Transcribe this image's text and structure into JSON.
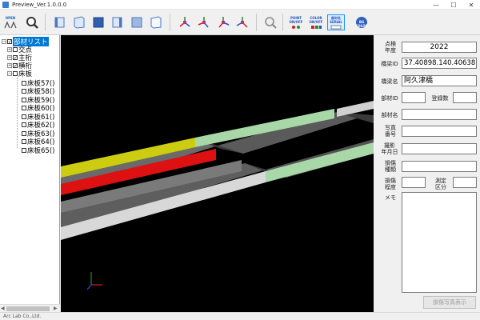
{
  "window": {
    "title": "Preview_Ver.1.0.0.0",
    "controls": [
      "—",
      "☐",
      "✕"
    ]
  },
  "toolbar": {
    "open_label": "OPEN",
    "point_label": "POINT\nON/OFF",
    "color_label": "COLOR\nON/OFF",
    "edit_label": "部材名\nSERIAL",
    "bg_color_label": "BG\nCOLOR"
  },
  "tree": {
    "root_label": "部材リスト",
    "nodes": [
      {
        "label": "交点",
        "expanded": false,
        "checked": false
      },
      {
        "label": "主桁",
        "expanded": false,
        "checked": true
      },
      {
        "label": "横桁",
        "expanded": false,
        "checked": true
      },
      {
        "label": "床板",
        "expanded": true,
        "checked": false
      }
    ],
    "children": [
      "床板57()",
      "床板58()",
      "床板59()",
      "床板60()",
      "床板61()",
      "床板62()",
      "床板63()",
      "床板64()",
      "床板65()"
    ]
  },
  "details": {
    "inspection_year_label": "点検\n年度",
    "inspection_year_value": "2022",
    "bridge_id_label": "橋梁ID",
    "bridge_id_value": "37.40898.140.40638",
    "bridge_name_label": "橋梁名",
    "bridge_name_value": "阿久津橋",
    "member_id_label": "部材ID",
    "member_id_value": "",
    "register_count_label": "登録数",
    "register_count_value": "",
    "member_name_label": "部材名",
    "member_name_value": "",
    "photo_number_label": "写真\n番号",
    "photo_number_value": "",
    "date_label": "撮影\n年月日",
    "date_value": "",
    "damage_type_label": "損傷\n種類",
    "damage_type_value": "",
    "damage_degree_label": "損傷\n程度",
    "damage_degree_value": "",
    "measurement_label": "測定\n区分",
    "measurement_value": "",
    "memo_label": "メモ",
    "photo_button_label": "損傷写真表示"
  },
  "status": {
    "text": "Arc Lab Co.,Ltd."
  },
  "colors": {
    "viewport_bg": "#000000",
    "beam_yellow": "#cccc10",
    "beam_red": "#dd1111",
    "beam_green": "#a8d8a8",
    "beam_white": "#d8d8d8",
    "tree_select": "#0078d7"
  }
}
